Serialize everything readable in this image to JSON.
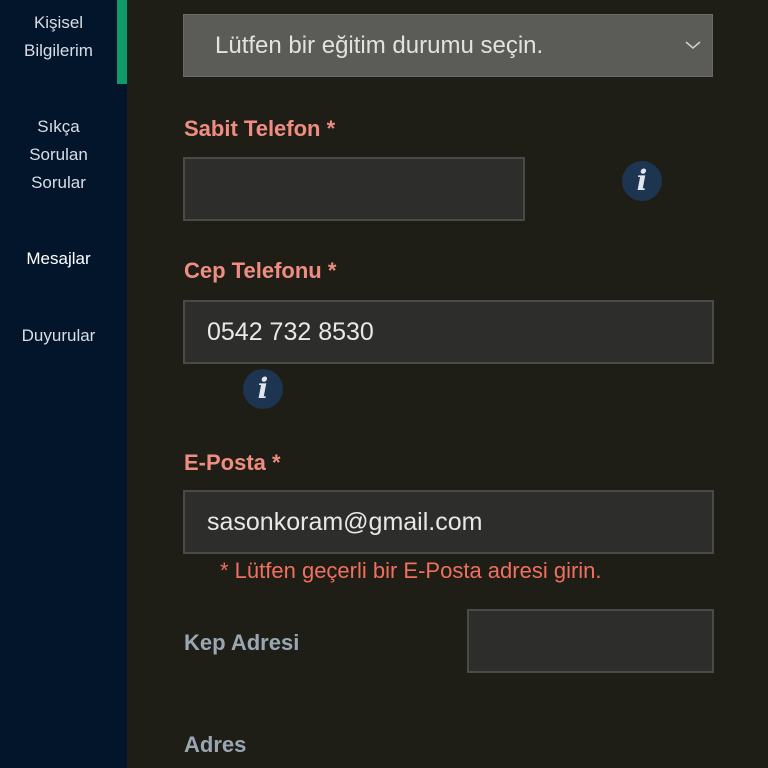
{
  "sidebar": {
    "items": [
      {
        "label_line1": "Kişisel",
        "label_line2": "Bilgilerim"
      },
      {
        "label_line1": "Sıkça",
        "label_line2": "Sorulan",
        "label_line3": "Sorular"
      },
      {
        "label_line1": "Mesajlar"
      },
      {
        "label_line1": "Duyurular"
      }
    ],
    "accent_color": "#0f9a6b"
  },
  "form": {
    "education_select": {
      "value": "Lütfen bir eğitim durumu seçin."
    },
    "landline": {
      "label": "Sabit Telefon *",
      "value": ""
    },
    "mobile": {
      "label": "Cep Telefonu *",
      "value": "0542 732 8530"
    },
    "email": {
      "label": "E-Posta *",
      "value": "sasonkoram@gmail.com",
      "error": "* Lütfen geçerli bir E-Posta adresi girin."
    },
    "kep": {
      "label": "Kep Adresi",
      "value": ""
    },
    "address": {
      "label": "Adres"
    },
    "info_icon_glyph": "i"
  },
  "colors": {
    "required_label": "#f08d82",
    "optional_label": "#9aa7b3",
    "error": "#f06f60"
  }
}
